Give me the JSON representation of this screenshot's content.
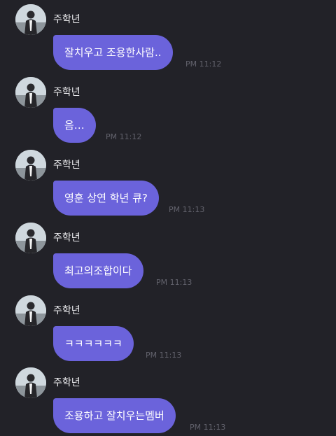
{
  "colors": {
    "background": "#222228",
    "bubble": "#6b63db",
    "name_text": "#ededf0",
    "time_text": "#62626c"
  },
  "avatar_icon": "profile-photo",
  "messages": [
    {
      "sender": "주학년",
      "text": "잘치우고 조용한사람..",
      "time": "PM 11:12"
    },
    {
      "sender": "주학년",
      "text": "음…",
      "time": "PM 11:12"
    },
    {
      "sender": "주학년",
      "text": "영훈 상연 학년 큐?",
      "time": "PM 11:13"
    },
    {
      "sender": "주학년",
      "text": "최고의조합이다",
      "time": "PM 11:13"
    },
    {
      "sender": "주학년",
      "text": "ㅋㅋㅋㅋㅋㅋ",
      "time": "PM 11:13"
    },
    {
      "sender": "주학년",
      "text": "조용하고 잘치우는멤버",
      "time": "PM 11:13"
    }
  ]
}
